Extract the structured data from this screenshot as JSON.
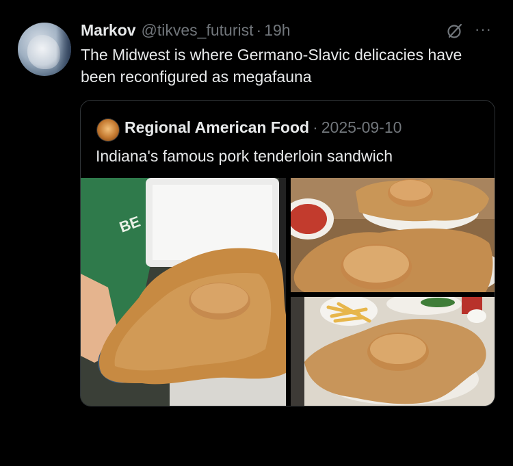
{
  "tweet": {
    "display_name": "Markov",
    "handle": "@tikves_futurist",
    "separator": "·",
    "time": "19h",
    "more": "···",
    "text": "The Midwest is where Germano-Slavic delicacies have been reconfigured as megafauna",
    "avatar_icon": "penguin-avatar"
  },
  "quote": {
    "display_name": "Regional American Food",
    "separator": "·",
    "date": "2025-09-10",
    "text": "Indiana's famous pork tenderloin sandwich",
    "avatar_icon": "food-avatar",
    "photos": [
      {
        "name": "photo-person-holding-tenderloin"
      },
      {
        "name": "photo-tenderloin-plates"
      },
      {
        "name": "photo-tenderloin-with-fries"
      }
    ]
  },
  "colors": {
    "background": "#000000",
    "text_primary": "#e7e9ea",
    "text_secondary": "#71767b",
    "border": "#2f3336"
  }
}
